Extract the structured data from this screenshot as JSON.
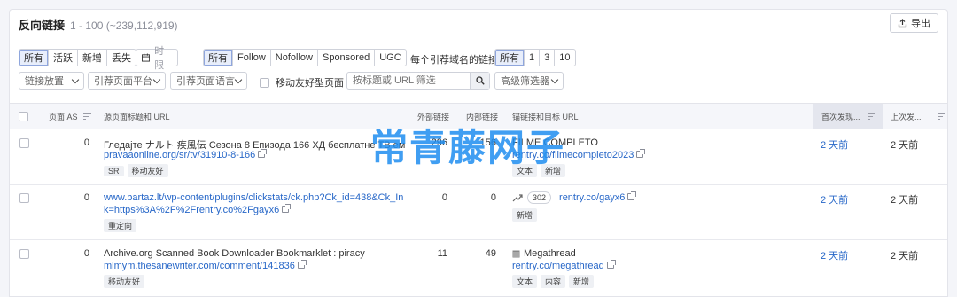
{
  "header": {
    "title": "反向链接",
    "range": "1 - 100 (~239,112,919)",
    "export_label": "导出"
  },
  "filters": {
    "status": [
      "所有",
      "活跃",
      "新增",
      "丢失"
    ],
    "time_label": "时限",
    "type": [
      "所有",
      "Follow",
      "Nofollow",
      "Sponsored",
      "UGC"
    ],
    "per_domain_label": "每个引荐域名的链接",
    "per_domain": [
      "所有",
      "1",
      "3",
      "10"
    ],
    "dropdowns": [
      "链接放置",
      "引荐页面平台",
      "引荐页面语言"
    ],
    "mobile_friendly_label": "移动友好型页面",
    "search_placeholder": "按标题或 URL 筛选",
    "advanced_label": "高级筛选器"
  },
  "columns": {
    "page_as": "页面 AS",
    "source": "源页面标题和 URL",
    "ext_links": "外部链接",
    "int_links": "内部链接",
    "anchor": "锚链接和目标 URL",
    "first_seen": "首次发现...",
    "last_seen": "上次发..."
  },
  "rows": [
    {
      "as": "0",
      "title": "Гледајте ナルト 疾風伝 Сезона 8 Епизода 166 ХД бесплатне ТВ ем...",
      "url": "pravaaonline.org/sr/tv/31910-8-166",
      "tags": [
        "SR",
        "移动友好"
      ],
      "ext": "296",
      "int": "156",
      "anchor": "FILME COMPLETO",
      "target": "rentry.co/filmecompleto2023",
      "anchor_tags": [
        "文本",
        "新增"
      ],
      "first": "2 天前",
      "last": "2 天前"
    },
    {
      "as": "0",
      "url1": "www.bartaz.lt/wp-content/plugins/clickstats/ck.php?Ck_id=438&Ck_In",
      "url2": "k=https%3A%2F%2Frentry.co%2Fgayx6",
      "tags": [
        "重定向"
      ],
      "ext": "0",
      "int": "0",
      "redirect_code": "302",
      "target": "rentry.co/gayx6",
      "anchor_tags": [
        "新增"
      ],
      "first": "2 天前",
      "last": "2 天前"
    },
    {
      "as": "0",
      "title": "Archive.org Scanned Book Downloader Bookmarklet : piracy",
      "url": "mlmym.thesanewriter.com/comment/141836",
      "tags": [
        "移动友好"
      ],
      "ext": "11",
      "int": "49",
      "anchor": "Megathread",
      "target": "rentry.co/megathread",
      "anchor_tags": [
        "文本",
        "内容",
        "新增"
      ],
      "first": "2 天前",
      "last": "2 天前"
    }
  ],
  "watermark": "常青藤网子"
}
